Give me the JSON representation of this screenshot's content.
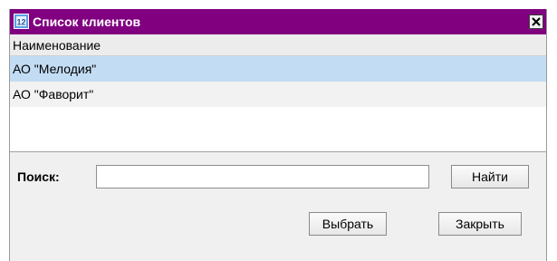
{
  "window": {
    "title": "Список клиентов",
    "title_bar_color": "#800080"
  },
  "icons": {
    "app": "app-icon",
    "close": "close-icon"
  },
  "list": {
    "column_header": "Наименование",
    "rows": [
      {
        "name": "АО \"Мелодия\"",
        "selected": true
      },
      {
        "name": "АО \"Фаворит\"",
        "selected": false
      }
    ],
    "selection_color": "#c2dcf4"
  },
  "search": {
    "label": "Поиск:",
    "value": "",
    "find_button": "Найти"
  },
  "buttons": {
    "select": "Выбрать",
    "close": "Закрыть"
  }
}
